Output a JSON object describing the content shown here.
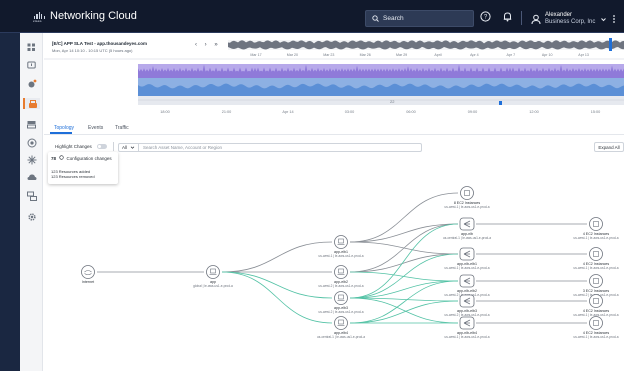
{
  "header": {
    "app_title": "Networking Cloud",
    "brand_name": "cisco",
    "search_label": "Search",
    "user_name": "Alexander",
    "user_org": "Business Corp, Inc",
    "accent": "#e77b2f"
  },
  "test": {
    "title": "[E/C] APP SLA Test - app.thousandeyes.com",
    "subtitle": "Mon, Apr 14 10:10 - 10:15 UTC (5 hours ago)",
    "nav": "‹ › »"
  },
  "timeline": {
    "overview_ticks": [
      "Mar 17",
      "Mar 20",
      "Mar 23",
      "Mar 26",
      "Mar 29",
      "April",
      "Apr 4",
      "Apr 7",
      "Apr 10",
      "Apr 13"
    ],
    "detail_ticks": [
      "18:00",
      "21:00",
      "Apr 14",
      "03:00",
      "06:00",
      "09:00",
      "12:00",
      "15:00"
    ],
    "value_label": "22",
    "series_colors": {
      "purple": "#8f7ad9",
      "blue": "#5b8fd6"
    }
  },
  "tabs": [
    {
      "label": "Topology",
      "active": true
    },
    {
      "label": "Events",
      "active": false
    },
    {
      "label": "Traffic",
      "active": false
    }
  ],
  "filters": {
    "highlight_label": "Highlight Changes",
    "select_value": "All",
    "search_placeholder": "Search Asset Name, Account or Region",
    "expand_label": "Expand All"
  },
  "changes": {
    "config_count": "78",
    "config_label": "Configuration changes",
    "added": "123 Resources added",
    "removed": "123 Resources removed"
  },
  "topology": {
    "nodes": [
      {
        "name": "Internet",
        "sub": ""
      },
      {
        "name": "app",
        "sub": "global | le-aws-us1-e-prod-a"
      },
      {
        "name": "app-elb1",
        "sub": "us-west-1 | le-aws-us1-e-prod-a"
      },
      {
        "name": "app-elb2",
        "sub": "us-west-2 | le-aws-us1-e-prod-a"
      },
      {
        "name": "app-elb3",
        "sub": "us-west-2 | le-aws-us1-e-prod-a"
      },
      {
        "name": "app-elb4",
        "sub": "us-central-1 | le-aws-us1-e-prod-a"
      },
      {
        "name": "8 EC2 Instances",
        "sub": "us-west-1 | le-aws-us1-e-prod-a"
      },
      {
        "name": "app-nlb",
        "sub": "us-central-1 | le-aws-us1-e-prod-a"
      },
      {
        "name": "app-nlb-elb1",
        "sub": "us-west-1 | le-aws-us1-e-prod-a"
      },
      {
        "name": "app-nlb-elb2",
        "sub": "us-west-2 | le-aws-us1-e-prod-a"
      },
      {
        "name": "app-nlb-elb3",
        "sub": "us-west-2 | le-aws-us1-e-prod-a"
      },
      {
        "name": "app-nlb-elb4",
        "sub": "us-west-1 | le-aws-us1-e-prod-a"
      },
      {
        "name": "4 EC2 Instances",
        "sub": "us-west-1 | le-aws-us1-e-prod-a"
      },
      {
        "name": "4 EC2 Instances",
        "sub": "us-west-1 | le-aws-us1-e-prod-a"
      },
      {
        "name": "3 EC2 Instances",
        "sub": "us-west-2 | le-aws-us1-e-prod-a"
      },
      {
        "name": "4 EC2 Instances",
        "sub": "us-west-1 | le-aws-us1-e-prod-a"
      },
      {
        "name": "4 EC2 Instances",
        "sub": "us-west-1 | le-aws-us1-e-prod-a"
      }
    ],
    "edge_colors": {
      "default": "#8a8f96",
      "highlight": "#53c2a5"
    }
  }
}
